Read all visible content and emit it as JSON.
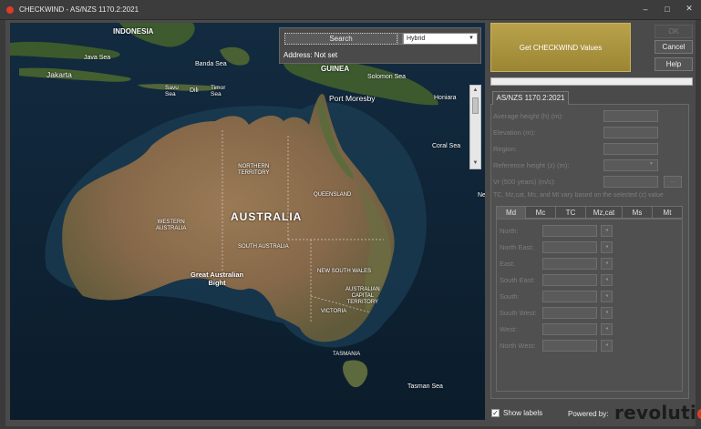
{
  "window": {
    "title": "CHECKWIND - AS/NZS 1170.2:2021",
    "minimize": "–",
    "maximize": "□",
    "close": "✕"
  },
  "map": {
    "search_label": "Search",
    "map_type": "Hybrid",
    "address": "Address: Not set",
    "labels": {
      "indonesia": "INDONESIA",
      "java_sea": "Java Sea",
      "jakarta": "Jakarta",
      "banda_sea": "Banda Sea",
      "savu_sea": "Savu\nSea",
      "dili": "Dili",
      "timor_sea": "Timor\nSea",
      "guinea": "GUINEA",
      "solomon_sea": "Solomon Sea",
      "port_moresby": "Port Moresby",
      "honiara": "Honiara",
      "coral_sea": "Coral Sea",
      "ne": "Ne",
      "northern_territory": "NORTHERN\nTERRITORY",
      "queensland": "QUEENSLAND",
      "western_australia": "WESTERN\nAUSTRALIA",
      "australia": "AUSTRALIA",
      "south_australia": "SOUTH AUSTRALIA",
      "new_south_wales": "NEW SOUTH WALES",
      "great_australian_bight": "Great Australian\nBight",
      "act": "AUSTRALIAN\nCAPITAL\nTERRITORY",
      "victoria": "VICTORIA",
      "tasmania": "TASMANIA",
      "tasman_sea": "Tasman Sea"
    }
  },
  "actions": {
    "get_values": "Get CHECKWIND Values",
    "ok": "OK",
    "cancel": "Cancel",
    "help": "Help"
  },
  "panel": {
    "tab": "AS/NZS 1170.2:2021",
    "fields": [
      "Average height (h) (m):",
      "Elevation (m):",
      "Region:",
      "Reference height (z) (m):",
      "Vr (500 years) (m/s):"
    ],
    "dots": "...",
    "note": "TC, Mz,cat, Ms, and Mt vary based on the selected (z) value",
    "dir_tabs": [
      "Md",
      "Mc",
      "TC",
      "Mz,cat",
      "Ms",
      "Mt"
    ],
    "directions": [
      "North:",
      "North East:",
      "East:",
      "South East:",
      "South:",
      "South West:",
      "West:",
      "North West:"
    ]
  },
  "footer": {
    "show_labels": "Show labels",
    "powered_by": "Powered by:",
    "logo_text": "revolutio"
  },
  "colors": {
    "accent_button": "#b09a42",
    "logo_accent": "#e0401f"
  }
}
